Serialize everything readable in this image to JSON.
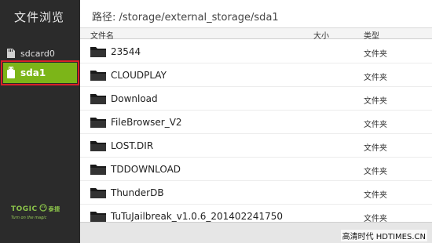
{
  "sidebar": {
    "title": "文件浏览",
    "items": [
      {
        "label": "sdcard0"
      },
      {
        "label": "sda1"
      }
    ],
    "logo": {
      "text": "TOGIC",
      "cn": "泰捷",
      "tagline": "Turn on the magic"
    }
  },
  "path": {
    "label": "路径: /storage/external_storage/sda1"
  },
  "columns": {
    "name": "文件名",
    "size": "大小",
    "type": "类型"
  },
  "files": [
    {
      "name": "23544",
      "type": "文件夹"
    },
    {
      "name": "CLOUDPLAY",
      "type": "文件夹"
    },
    {
      "name": "Download",
      "type": "文件夹"
    },
    {
      "name": "FileBrowser_V2",
      "type": "文件夹"
    },
    {
      "name": "LOST.DIR",
      "type": "文件夹"
    },
    {
      "name": "TDDOWNLOAD",
      "type": "文件夹"
    },
    {
      "name": "ThunderDB",
      "type": "文件夹"
    },
    {
      "name": "TuTuJailbreak_v1.0.6_201402241750",
      "type": "文件夹"
    }
  ],
  "watermark": "高清时代 HDTIMES.CN",
  "colors": {
    "sidebar_bg": "#2b2b2b",
    "active": "#7cb518",
    "highlight_border": "#d8202a"
  }
}
